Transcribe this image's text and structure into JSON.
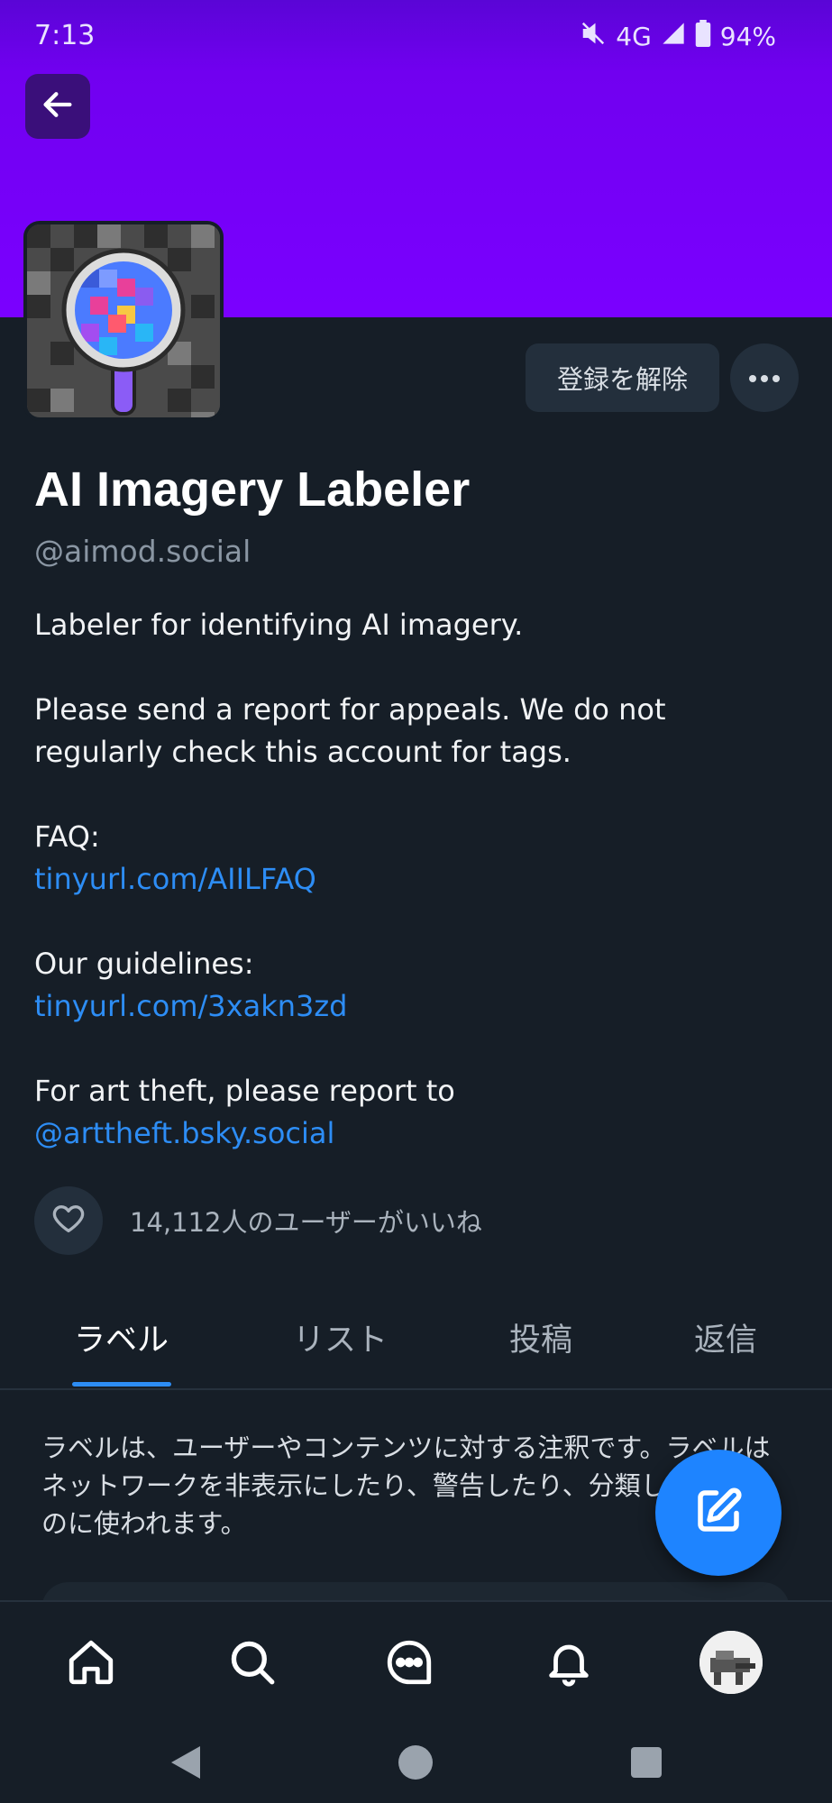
{
  "status_bar": {
    "time": "7:13",
    "network": "4G",
    "battery": "94%"
  },
  "header": {
    "back_icon": "arrow-left-icon",
    "banner_color": "#7a00ff"
  },
  "profile": {
    "name": "AI Imagery Labeler",
    "handle": "@aimod.social",
    "unsubscribe_label": "登録を解除",
    "more_icon": "ellipsis-icon",
    "bio": {
      "line1": "Labeler for identifying AI imagery.",
      "line2": "Please send a report for appeals. We do not regularly check this account for tags.",
      "faq_label": "FAQ:",
      "faq_link": "tinyurl.com/AIILFAQ",
      "guidelines_label": "Our guidelines:",
      "guidelines_link": "tinyurl.com/3xakn3zd",
      "art_theft_text": "For art theft, please report to ",
      "art_theft_handle": "@arttheft.bsky.social"
    },
    "likes_text": "14,112人のユーザーがいいね"
  },
  "tabs": [
    {
      "label": "ラベル",
      "active": true
    },
    {
      "label": "リスト",
      "active": false
    },
    {
      "label": "投稿",
      "active": false
    },
    {
      "label": "返信",
      "active": false
    }
  ],
  "labels_description": "ラベルは、ユーザーやコンテンツに対する注釈です。ラベルはネットワークを非表示にしたり、警告したり、分類したりするのに使われます。",
  "fab": {
    "icon": "compose-icon"
  },
  "bottom_nav": {
    "items": [
      "home-icon",
      "search-icon",
      "chat-icon",
      "bell-icon",
      "profile-avatar"
    ]
  },
  "accent_color": "#2d8df5"
}
